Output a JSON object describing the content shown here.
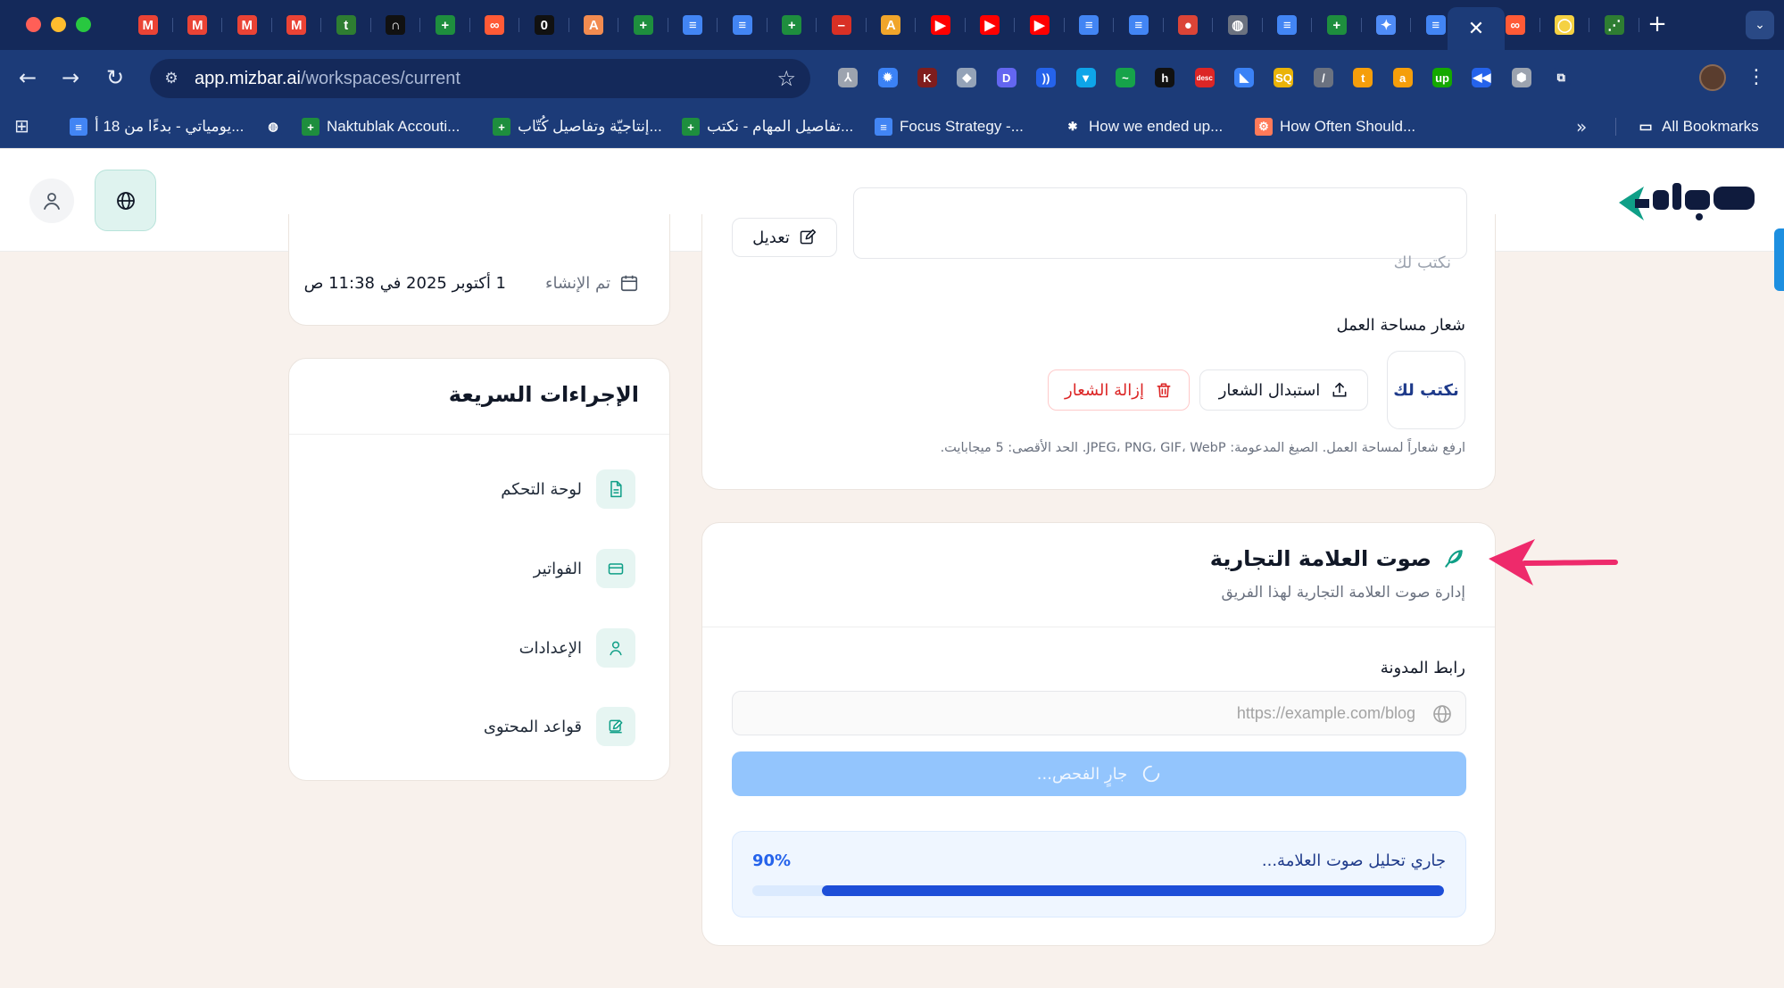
{
  "browser": {
    "url_host": "app.mizbar.ai",
    "url_path": "/workspaces/current",
    "tabs": [
      {
        "icon": "gmail-icon",
        "glyph": "M",
        "color": "#ea4335"
      },
      {
        "icon": "gmail-icon",
        "glyph": "M",
        "color": "#ea4335"
      },
      {
        "icon": "gmail-icon",
        "glyph": "M",
        "color": "#ea4335"
      },
      {
        "icon": "gmail-icon",
        "glyph": "M",
        "color": "#ea4335"
      },
      {
        "icon": "t-app-icon",
        "glyph": "t",
        "color": "#2e7d32"
      },
      {
        "icon": "n-app-icon",
        "glyph": "∩",
        "color": "#111111"
      },
      {
        "icon": "sheets-icon",
        "glyph": "+",
        "color": "#1e8e3e"
      },
      {
        "icon": "loop-icon",
        "glyph": "∞",
        "color": "#ff5a36"
      },
      {
        "icon": "zero-app-icon",
        "glyph": "0",
        "color": "#111111"
      },
      {
        "icon": "a-app-icon",
        "glyph": "A",
        "color": "#f28b50"
      },
      {
        "icon": "sheets-icon",
        "glyph": "+",
        "color": "#1e8e3e"
      },
      {
        "icon": "docs-icon",
        "glyph": "≡",
        "color": "#4285f4"
      },
      {
        "icon": "docs-icon",
        "glyph": "≡",
        "color": "#4285f4"
      },
      {
        "icon": "sheets-icon",
        "glyph": "+",
        "color": "#1e8e3e"
      },
      {
        "icon": "minus-app-icon",
        "glyph": "–",
        "color": "#d93025"
      },
      {
        "icon": "artstation-icon",
        "glyph": "A",
        "color": "#f0a52b"
      },
      {
        "icon": "youtube-icon",
        "glyph": "▶",
        "color": "#ff0000"
      },
      {
        "icon": "youtube-icon",
        "glyph": "▶",
        "color": "#ff0000"
      },
      {
        "icon": "youtube-icon",
        "glyph": "▶",
        "color": "#ff0000"
      },
      {
        "icon": "docs-icon",
        "glyph": "≡",
        "color": "#4285f4"
      },
      {
        "icon": "docs-icon",
        "glyph": "≡",
        "color": "#4285f4"
      },
      {
        "icon": "chrome-icon",
        "glyph": "●",
        "color": "#db4437"
      },
      {
        "icon": "globe-icon",
        "glyph": "◍",
        "color": "#6b7280"
      },
      {
        "icon": "docs-icon",
        "glyph": "≡",
        "color": "#4285f4"
      },
      {
        "icon": "sheets-icon",
        "glyph": "+",
        "color": "#1e8e3e"
      },
      {
        "icon": "gemini-icon",
        "glyph": "✦",
        "color": "#4f8cf7"
      },
      {
        "icon": "docs-icon",
        "glyph": "≡",
        "color": "#4285f4"
      }
    ],
    "trailing_tabs": [
      {
        "icon": "loop-icon",
        "glyph": "∞",
        "color": "#ff5a36"
      },
      {
        "icon": "bulb-icon",
        "glyph": "◯",
        "color": "#f5d142"
      },
      {
        "icon": "chart-app-icon",
        "glyph": "⋰",
        "color": "#2e7d32"
      }
    ],
    "extensions": [
      {
        "icon": "person-ext-icon",
        "glyph": "⅄",
        "color": "#9ca3af"
      },
      {
        "icon": "gear-ext-icon",
        "glyph": "✹",
        "color": "#3b82f6"
      },
      {
        "icon": "k-ext-icon",
        "glyph": "K",
        "color": "#7f1d1d"
      },
      {
        "icon": "bird-ext-icon",
        "glyph": "◆",
        "color": "#94a3b8"
      },
      {
        "icon": "d-ext-icon",
        "glyph": "D",
        "color": "#6366f1"
      },
      {
        "icon": "wave-ext-icon",
        "glyph": "))",
        "color": "#2563eb"
      },
      {
        "icon": "shield-ext-icon",
        "glyph": "▼",
        "color": "#0ea5e9"
      },
      {
        "icon": "leaf-ext-icon",
        "glyph": "~",
        "color": "#16a34a"
      },
      {
        "icon": "h-ext-icon",
        "glyph": "h",
        "color": "#111111"
      },
      {
        "icon": "desc-ext-icon",
        "glyph": "desc",
        "color": "#dc2626"
      },
      {
        "icon": "tag-ext-icon",
        "glyph": "◣",
        "color": "#3b82f6"
      },
      {
        "icon": "sq-ext-icon",
        "glyph": "SQ",
        "color": "#eab308"
      },
      {
        "icon": "wand-ext-icon",
        "glyph": "/",
        "color": "#6b7280"
      },
      {
        "icon": "t-ext-icon",
        "glyph": "t",
        "color": "#f59e0b"
      },
      {
        "icon": "amazon-ext-icon",
        "glyph": "a",
        "color": "#f59e0b"
      },
      {
        "icon": "upwork-ext-icon",
        "glyph": "up",
        "color": "#14a800"
      },
      {
        "icon": "rewind-ext-icon",
        "glyph": "◀◀",
        "color": "#2563eb"
      },
      {
        "icon": "hex-ext-icon",
        "glyph": "⬢",
        "color": "#9ca3af"
      },
      {
        "icon": "puzzle-icon",
        "glyph": "⧉",
        "color": "#1c3b78"
      }
    ],
    "bookmarks": [
      {
        "label": "يومياتي - بدءًا من 18 أ...",
        "icon": "docs-icon",
        "color": "#4285f4",
        "glyph": "≡"
      },
      {
        "label": "",
        "icon": "globe-icon",
        "color": "#1c3b78",
        "glyph": "◍"
      },
      {
        "label": "Naktublak Accouti...",
        "icon": "sheets-icon",
        "color": "#1e8e3e",
        "glyph": "+"
      },
      {
        "label": "إنتاجيّة وتفاصيل كُتّاب...",
        "icon": "sheets-icon",
        "color": "#1e8e3e",
        "glyph": "+"
      },
      {
        "label": "تفاصيل المهام - نكتب...",
        "icon": "sheets-icon",
        "color": "#1e8e3e",
        "glyph": "+"
      },
      {
        "label": "Focus Strategy -...",
        "icon": "docs-icon",
        "color": "#4285f4",
        "glyph": "≡"
      },
      {
        "label": "How we ended up...",
        "icon": "asterisk-icon",
        "color": "#1c3b78",
        "glyph": "✱"
      },
      {
        "label": "How Often Should...",
        "icon": "hubspot-icon",
        "color": "#ff7a59",
        "glyph": "⚙"
      }
    ],
    "all_bookmarks": "All Bookmarks"
  },
  "info_card": {
    "label": "تم الإنشاء",
    "value": "1 أكتوبر 2025 في 11:38 ص"
  },
  "quick_actions": {
    "title": "الإجراءات السريعة",
    "items": [
      {
        "label": "لوحة التحكم",
        "icon": "document-icon"
      },
      {
        "label": "الفواتير",
        "icon": "credit-card-icon"
      },
      {
        "label": "الإعدادات",
        "icon": "user-icon"
      },
      {
        "label": "قواعد المحتوى",
        "icon": "edit-icon"
      }
    ]
  },
  "workspace": {
    "name_placeholder": "نكتب لك",
    "edit_label": "تعديل",
    "logo_label": "شعار مساحة العمل",
    "logo_text": "نكتب لك",
    "replace_label": "استبدال الشعار",
    "remove_label": "إزالة الشعار",
    "logo_hint": "ارفع شعاراً لمساحة العمل. الصيغ المدعومة: JPEG، PNG، GIF، WebP. الحد الأقصى: 5 ميجابايت."
  },
  "brand_voice": {
    "title": "صوت العلامة التجارية",
    "subtitle": "إدارة صوت العلامة التجارية لهذا الفريق",
    "blog_label": "رابط المدونة",
    "blog_placeholder": "https://example.com/blog",
    "scan_label": "جارٍ الفحص...",
    "progress_text": "جاري تحليل صوت العلامة...",
    "progress_pct_label": "90%",
    "progress": 0.9
  },
  "colors": {
    "brand_teal": "#0f9f87",
    "accent_blue": "#1d4ed8",
    "danger": "#dc2626",
    "annotation_arrow": "#ee2a6b"
  }
}
